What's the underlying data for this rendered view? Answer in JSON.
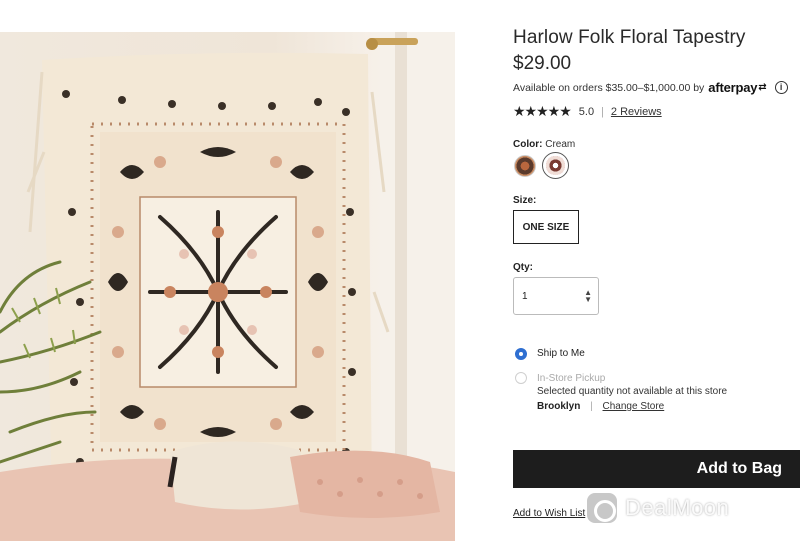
{
  "product": {
    "title": "Harlow Folk Floral Tapestry",
    "price": "$29.00",
    "afterpay_text": "Available on orders $35.00–$1,000.00 by",
    "afterpay_brand": "afterpay",
    "afterpay_mark": "⇄",
    "info_glyph": "i",
    "stars": "★★★★★",
    "rating": "5.0",
    "rating_separator": "|",
    "reviews_link": "2 Reviews",
    "color_label": "Color:",
    "color_value": "Cream",
    "swatches": [
      "swatch-multi-brown",
      "swatch-cream-selected"
    ],
    "size_label": "Size:",
    "size_option": "ONE SIZE",
    "qty_label": "Qty:",
    "qty_value": "1",
    "qty_stepper_up": "▲",
    "qty_stepper_down": "▼"
  },
  "fulfillment": {
    "ship_to_me": "Ship to Me",
    "in_store_pickup": "In-Store Pickup",
    "store_note": "Selected quantity not available at this store",
    "store_name": "Brooklyn",
    "store_separator": "|",
    "change_store": "Change Store"
  },
  "actions": {
    "add_to_bag": "Add to Bag",
    "wish_list": "Add to Wish List"
  },
  "watermark": {
    "text": "DealMoon"
  },
  "icons": {
    "info": "info-icon",
    "stepper": "stepper-icon",
    "star": "star-icon"
  }
}
